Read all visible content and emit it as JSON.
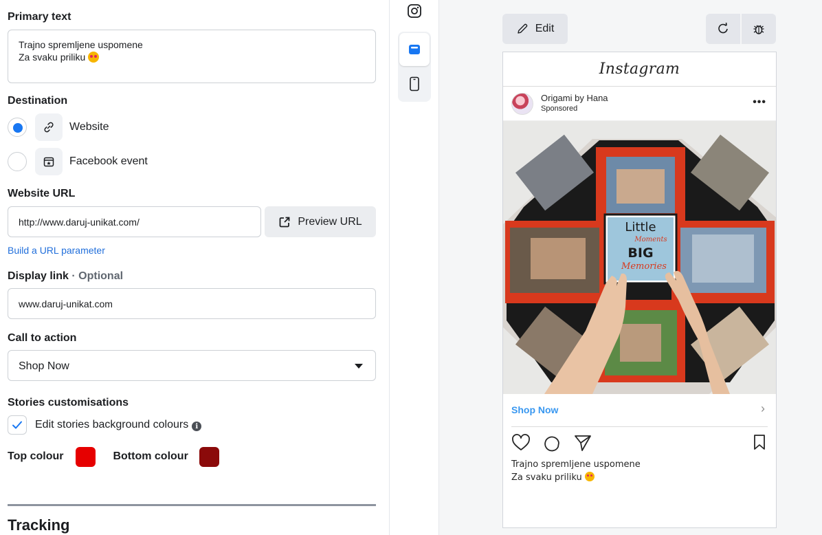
{
  "form": {
    "primary_text": {
      "label": "Primary text",
      "line1": "Trajno spremljene uspomene",
      "line2": "Za svaku priliku"
    },
    "destination": {
      "label": "Destination",
      "options": [
        {
          "label": "Website",
          "selected": true,
          "icon": "link-icon"
        },
        {
          "label": "Facebook event",
          "selected": false,
          "icon": "event-icon"
        }
      ]
    },
    "website_url": {
      "label": "Website URL",
      "value": "http://www.daruj-unikat.com/",
      "preview_button": "Preview URL",
      "build_param_link": "Build a URL parameter"
    },
    "display_link": {
      "label": "Display link",
      "optional": "· Optional",
      "value": "www.daruj-unikat.com"
    },
    "call_to_action": {
      "label": "Call to action",
      "value": "Shop Now"
    },
    "stories": {
      "label": "Stories customisations",
      "checkbox_label": "Edit stories background colours",
      "checked": true,
      "top_colour_label": "Top colour",
      "top_colour": "#e60000",
      "bottom_colour_label": "Bottom colour",
      "bottom_colour": "#8b0a0a"
    },
    "tracking_heading": "Tracking"
  },
  "rail": {
    "items": [
      "instagram-icon",
      "feed-preview-icon",
      "mobile-preview-icon"
    ],
    "active": "feed-preview-icon"
  },
  "preview": {
    "edit_button": "Edit",
    "tools": [
      "refresh-icon",
      "bug-icon"
    ],
    "platform_logo": "Instagram",
    "account_name": "Origami by Hana",
    "sponsored": "Sponsored",
    "cta_label": "Shop Now",
    "caption_line1": "Trajno spremljene uspomene",
    "caption_line2": "Za svaku priliku",
    "media_text": {
      "word1": "Little",
      "word2": "Moments",
      "word3": "BIG",
      "word4": "Memories"
    }
  },
  "colors": {
    "accent": "#1877f2",
    "link": "#216fdb",
    "ig_cta": "#3897f0"
  }
}
